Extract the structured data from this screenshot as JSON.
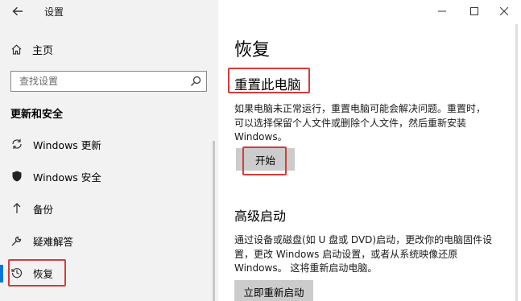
{
  "window": {
    "title": "设置"
  },
  "sidebar": {
    "home_label": "主页",
    "search_placeholder": "查找设置",
    "section_title": "更新和安全",
    "items": [
      {
        "label": "Windows 更新",
        "icon": "sync-icon"
      },
      {
        "label": "Windows 安全",
        "icon": "shield-icon"
      },
      {
        "label": "备份",
        "icon": "backup-arrow-icon"
      },
      {
        "label": "疑难解答",
        "icon": "wrench-icon"
      },
      {
        "label": "恢复",
        "icon": "history-icon",
        "active": true
      }
    ]
  },
  "main": {
    "title": "恢复",
    "reset": {
      "heading": "重置此电脑",
      "description_line1": "如果电脑未正常运行，重置电脑可能会解决问题。重置时，",
      "description_line2": "可以选择保留个人文件或删除个人文件，然后重新安装",
      "description_line3": "Windows。",
      "button_label": "开始"
    },
    "advanced": {
      "heading": "高级启动",
      "description_line1": "通过设备或磁盘(如 U 盘或 DVD)启动，更改你的电脑固件设",
      "description_line2": "置，更改 Windows 启动设置，或者从系统映像还原",
      "description_line3": "Windows。 这将重新启动电脑。",
      "button_label": "立即重新启动"
    }
  },
  "colors": {
    "sidebar_bg": "#f2f2f2",
    "accent": "#0078d7",
    "highlight_box": "#d83a3a",
    "button_bg": "#cccccc"
  }
}
